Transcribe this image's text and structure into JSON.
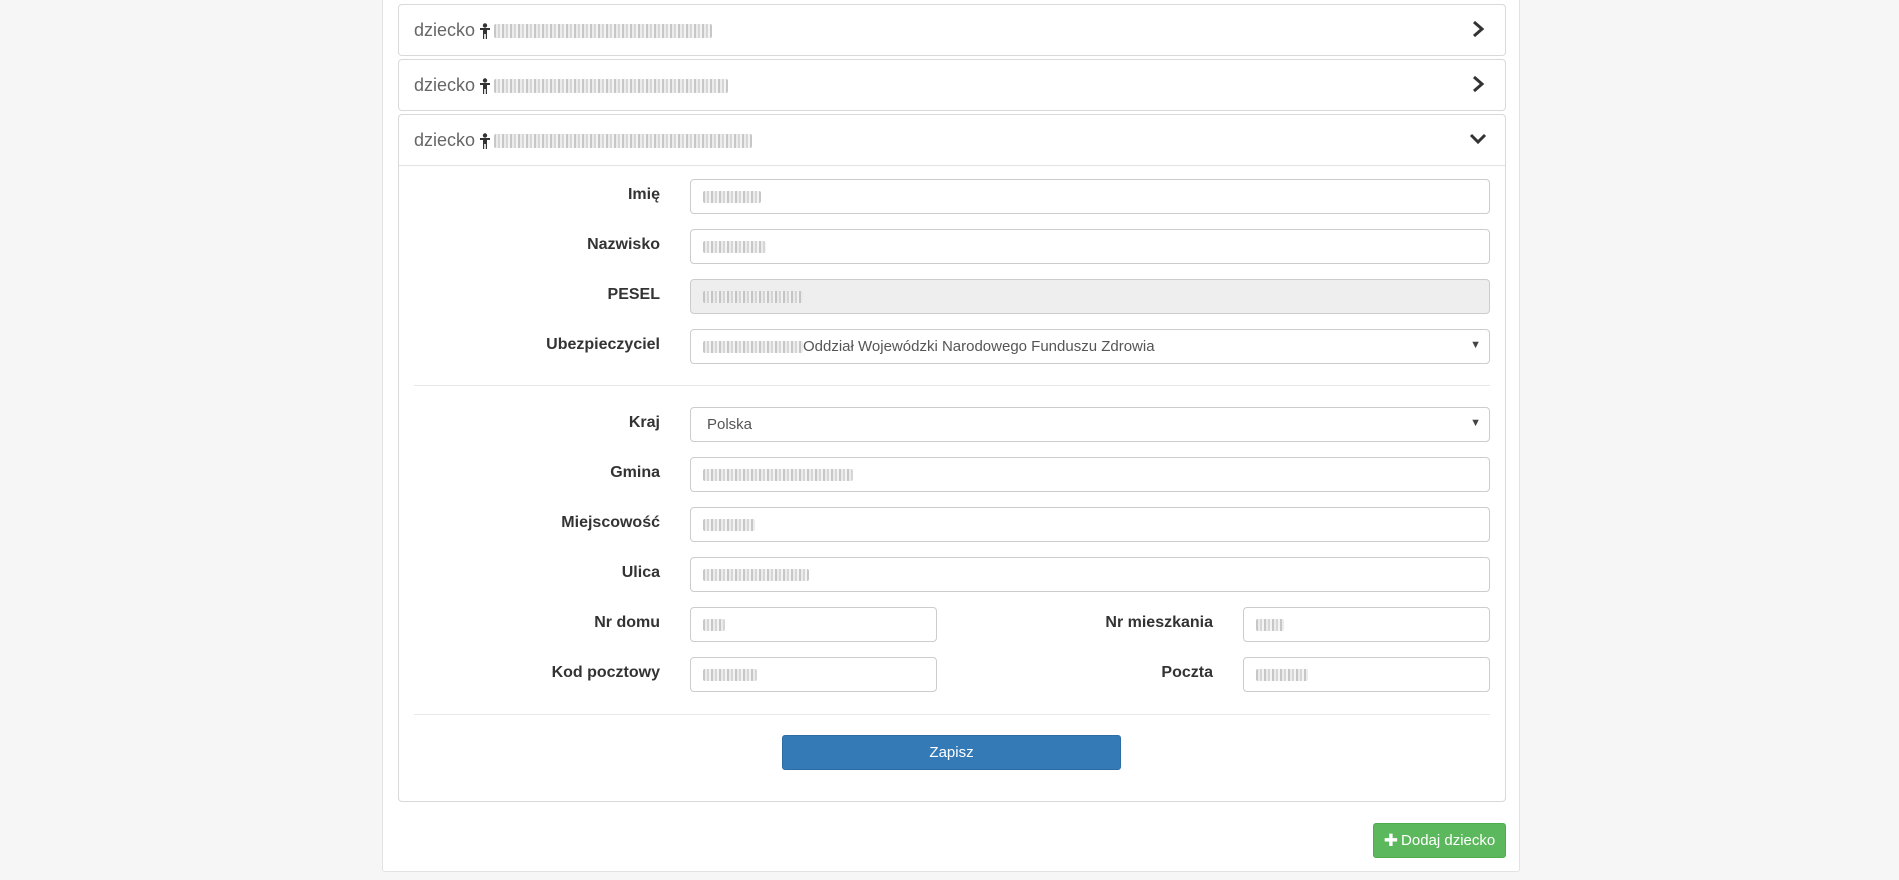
{
  "children": [
    {
      "prefix": "dziecko",
      "expanded": false
    },
    {
      "prefix": "dziecko",
      "expanded": false
    },
    {
      "prefix": "dziecko",
      "expanded": true
    }
  ],
  "form": {
    "first_name_label": "Imię",
    "last_name_label": "Nazwisko",
    "pesel_label": "PESEL",
    "insurer_label": "Ubezpieczyciel",
    "insurer_value": "Oddział Wojewódzki Narodowego Funduszu Zdrowia",
    "country_label": "Kraj",
    "country_value": "Polska",
    "commune_label": "Gmina",
    "city_label": "Miejscowość",
    "street_label": "Ulica",
    "house_no_label": "Nr domu",
    "flat_no_label": "Nr mieszkania",
    "postal_code_label": "Kod pocztowy",
    "post_office_label": "Poczta",
    "save_label": "Zapisz"
  },
  "add_child_label": "Dodaj dziecko",
  "icons": {
    "child": "child-icon",
    "collapsed": "chevron-right-icon",
    "expanded": "chevron-down-icon",
    "dropdown": "caret-down-icon",
    "add": "plus-icon"
  },
  "colors": {
    "primary": "#337ab7",
    "success": "#5cb85c",
    "disabled_field": "#eeeeee"
  }
}
